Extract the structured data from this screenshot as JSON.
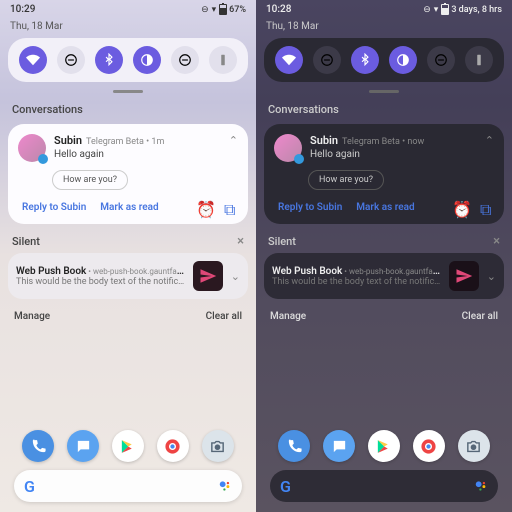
{
  "light": {
    "time": "10:29",
    "date": "Thu, 18 Mar",
    "battery": "67%",
    "qs": [
      "wifi",
      "dnd",
      "bluetooth",
      "dark",
      "nearby",
      "flashlight"
    ],
    "sec_conv": "Conversations",
    "conv": {
      "name": "Subin",
      "meta": "Telegram Beta  •  1m",
      "text": "Hello again",
      "sugg": "How are you?",
      "reply": "Reply to Subin",
      "mark": "Mark as read"
    },
    "sec_silent": "Silent",
    "push": {
      "title": "Web Push Book",
      "meta": " • web-push-book.gauntface.c… • now",
      "body": "This would be the body text of the notification. It…"
    },
    "manage": "Manage",
    "clear": "Clear all"
  },
  "dark": {
    "time": "10:28",
    "date": "Thu, 18 Mar",
    "battery_extra": "3 days, 8 hrs",
    "qs": [
      "wifi",
      "dnd",
      "bluetooth",
      "dark",
      "nearby",
      "flashlight"
    ],
    "sec_conv": "Conversations",
    "conv": {
      "name": "Subin",
      "meta": "Telegram Beta  •  now",
      "text": "Hello again",
      "sugg": "How are you?",
      "reply": "Reply to Subin",
      "mark": "Mark as read"
    },
    "sec_silent": "Silent",
    "push": {
      "title": "Web Push Book",
      "meta": " • web-push-book.gauntface.c… • now",
      "body": "This would be the body text of the notification. It…"
    },
    "manage": "Manage",
    "clear": "Clear all"
  }
}
